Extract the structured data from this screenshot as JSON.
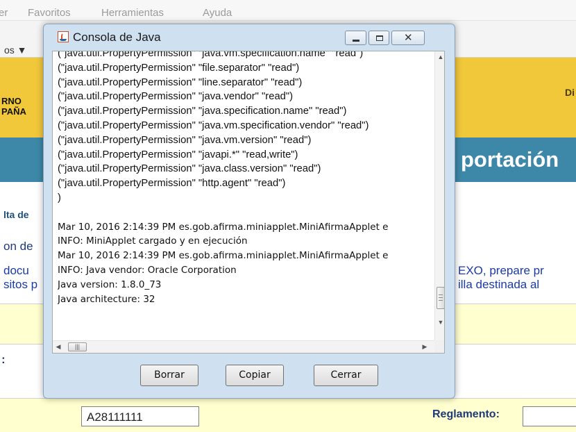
{
  "browser": {
    "menu": [
      "er",
      "Favoritos",
      "Herramientas",
      "Ayuda"
    ],
    "tools_label": "os ▼"
  },
  "page": {
    "header_gov": [
      "RNO",
      "PAÑA"
    ],
    "header_dir": "Di",
    "title_fragment": "portación",
    "consulta": "lta de",
    "left_fragments": [
      "on de",
      "docu",
      "sitos p",
      ":"
    ],
    "right_fragments": [
      "EXO, prepare pr",
      "illa destinada al"
    ],
    "nif_value": "A28111111",
    "reglamento_label": "Reglamento:"
  },
  "dialog": {
    "title": "Consola de Java",
    "icon": "java-coffee-icon",
    "lines": [
      "(\"java.util.PropertyPermission\" \"java.vm.specification.name\" \"read\")",
      "(\"java.util.PropertyPermission\" \"file.separator\" \"read\")",
      "(\"java.util.PropertyPermission\" \"line.separator\" \"read\")",
      "(\"java.util.PropertyPermission\" \"java.vendor\" \"read\")",
      "(\"java.util.PropertyPermission\" \"java.specification.name\" \"read\")",
      "(\"java.util.PropertyPermission\" \"java.vm.specification.vendor\" \"read\")",
      "(\"java.util.PropertyPermission\" \"java.vm.version\" \"read\")",
      "(\"java.util.PropertyPermission\" \"javapi.*\" \"read,write\")",
      "(\"java.util.PropertyPermission\" \"java.class.version\" \"read\")",
      "(\"java.util.PropertyPermission\" \"http.agent\" \"read\")",
      ")",
      "",
      "Mar 10, 2016 2:14:39 PM es.gob.afirma.miniapplet.MiniAfirmaApplet e",
      "INFO: MiniApplet cargado y en ejecución",
      "Mar 10, 2016 2:14:39 PM es.gob.afirma.miniapplet.MiniAfirmaApplet e",
      "INFO: Java vendor: Oracle Corporation",
      "Java version: 1.8.0_73",
      "Java architecture: 32"
    ],
    "buttons": {
      "borrar": "Borrar",
      "copiar": "Copiar",
      "cerrar": "Cerrar"
    },
    "hscroll_thumb_glyph": "|||"
  }
}
